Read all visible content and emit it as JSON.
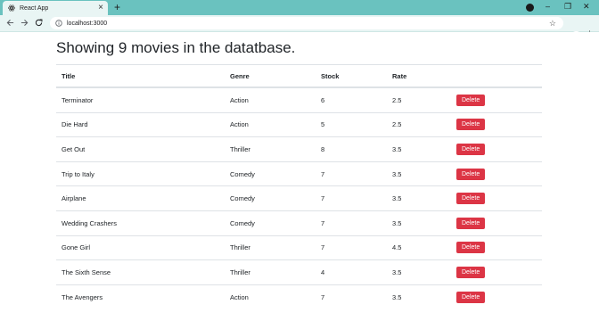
{
  "browser": {
    "tab_title": "React App",
    "url": "localhost:3000",
    "new_tab": "+",
    "close_tab": "×"
  },
  "page": {
    "title": "Showing 9 movies in the datatbase."
  },
  "table": {
    "headers": [
      "Title",
      "Genre",
      "Stock",
      "Rate",
      ""
    ],
    "rows": [
      {
        "title": "Terminator",
        "genre": "Action",
        "stock": "6",
        "rate": "2.5",
        "action": "Delete"
      },
      {
        "title": "Die Hard",
        "genre": "Action",
        "stock": "5",
        "rate": "2.5",
        "action": "Delete"
      },
      {
        "title": "Get Out",
        "genre": "Thriller",
        "stock": "8",
        "rate": "3.5",
        "action": "Delete"
      },
      {
        "title": "Trip to Italy",
        "genre": "Comedy",
        "stock": "7",
        "rate": "3.5",
        "action": "Delete"
      },
      {
        "title": "Airplane",
        "genre": "Comedy",
        "stock": "7",
        "rate": "3.5",
        "action": "Delete"
      },
      {
        "title": "Wedding Crashers",
        "genre": "Comedy",
        "stock": "7",
        "rate": "3.5",
        "action": "Delete"
      },
      {
        "title": "Gone Girl",
        "genre": "Thriller",
        "stock": "7",
        "rate": "4.5",
        "action": "Delete"
      },
      {
        "title": "The Sixth Sense",
        "genre": "Thriller",
        "stock": "4",
        "rate": "3.5",
        "action": "Delete"
      },
      {
        "title": "The Avengers",
        "genre": "Action",
        "stock": "7",
        "rate": "3.5",
        "action": "Delete"
      }
    ]
  },
  "colors": {
    "browser_frame": "#6ac2bf",
    "delete_button": "#dc3545"
  }
}
